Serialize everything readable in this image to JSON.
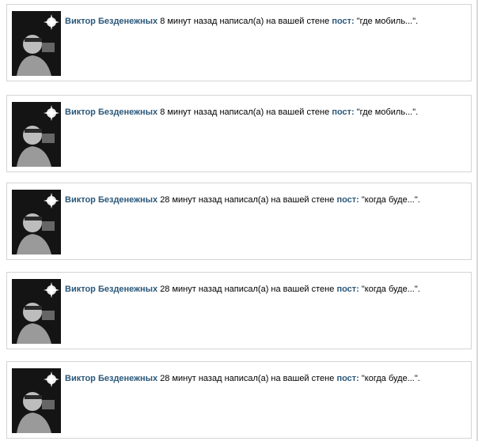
{
  "feed": {
    "items": [
      {
        "author": "Виктор Безденежных",
        "time": "8 минут назад",
        "action": "написал(а) на вашей стене",
        "post_label": "пост:",
        "quote": "\"где мобиль...\"."
      },
      {
        "author": "Виктор Безденежных",
        "time": "8 минут назад",
        "action": "написал(а) на вашей стене",
        "post_label": "пост:",
        "quote": "\"где мобиль...\"."
      },
      {
        "author": "Виктор Безденежных",
        "time": "28 минут назад",
        "action": "написал(а) на вашей стене",
        "post_label": "пост:",
        "quote": "\"когда буде...\"."
      },
      {
        "author": "Виктор Безденежных",
        "time": "28 минут назад",
        "action": "написал(а) на вашей стене",
        "post_label": "пост:",
        "quote": "\"когда буде...\"."
      },
      {
        "author": "Виктор Безденежных",
        "time": "28 минут назад",
        "action": "написал(а) на вашей стене",
        "post_label": "пост:",
        "quote": "\"когда буде...\"."
      }
    ]
  }
}
